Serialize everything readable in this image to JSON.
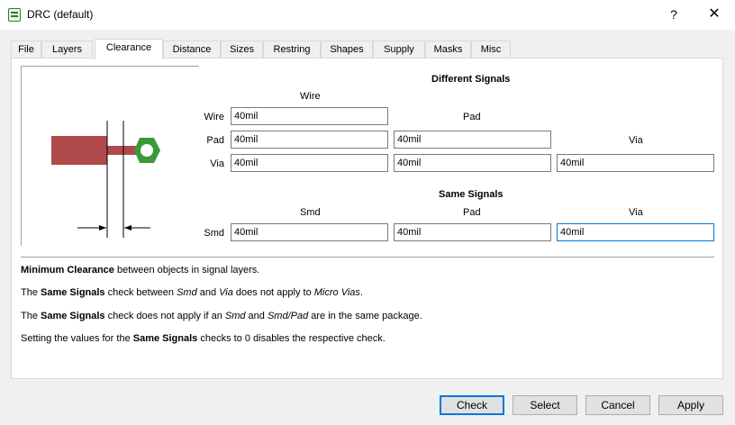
{
  "window": {
    "title": "DRC (default)",
    "help_label": "?",
    "close_label": "✕"
  },
  "tabs": [
    {
      "label": "File"
    },
    {
      "label": "Layers"
    },
    {
      "label": "Clearance"
    },
    {
      "label": "Distance"
    },
    {
      "label": "Sizes"
    },
    {
      "label": "Restring"
    },
    {
      "label": "Shapes"
    },
    {
      "label": "Supply"
    },
    {
      "label": "Masks"
    },
    {
      "label": "Misc"
    }
  ],
  "active_tab": "Clearance",
  "clearance": {
    "different_signals": {
      "heading": "Different Signals",
      "columns": {
        "wire": "Wire",
        "pad": "Pad",
        "via": "Via"
      },
      "rows": {
        "wire": "Wire",
        "pad": "Pad",
        "via": "Via"
      },
      "values": {
        "wire_wire": "40mil",
        "pad_wire": "40mil",
        "pad_pad": "40mil",
        "via_wire": "40mil",
        "via_pad": "40mil",
        "via_via": "40mil"
      }
    },
    "same_signals": {
      "heading": "Same Signals",
      "columns": {
        "smd": "Smd",
        "pad": "Pad",
        "via": "Via"
      },
      "row": "Smd",
      "values": {
        "smd_smd": "40mil",
        "smd_pad": "40mil",
        "smd_via": "40mil"
      }
    }
  },
  "notes": {
    "n1_b1": "Minimum Clearance",
    "n1_t1": " between objects in signal layers.",
    "n2_t1": "The ",
    "n2_b1": "Same Signals",
    "n2_t2": " check between ",
    "n2_i1": "Smd",
    "n2_t3": " and ",
    "n2_i2": "Via",
    "n2_t4": " does not apply to ",
    "n2_i3": "Micro Vias",
    "n2_t5": ".",
    "n3_t1": "The ",
    "n3_b1": "Same Signals",
    "n3_t2": " check does not apply if an ",
    "n3_i1": "Smd",
    "n3_t3": " and ",
    "n3_i2": "Smd/Pad",
    "n3_t4": " are in the same package.",
    "n4_t1": "Setting the values for the ",
    "n4_b1": "Same Signals",
    "n4_t2": " checks to 0 disables the respective check."
  },
  "buttons": {
    "check": "Check",
    "select": "Select",
    "cancel": "Cancel",
    "apply": "Apply"
  },
  "colors": {
    "wire": "#b04a4a",
    "pad": "#3a9a3a",
    "accent": "#0078d7"
  }
}
